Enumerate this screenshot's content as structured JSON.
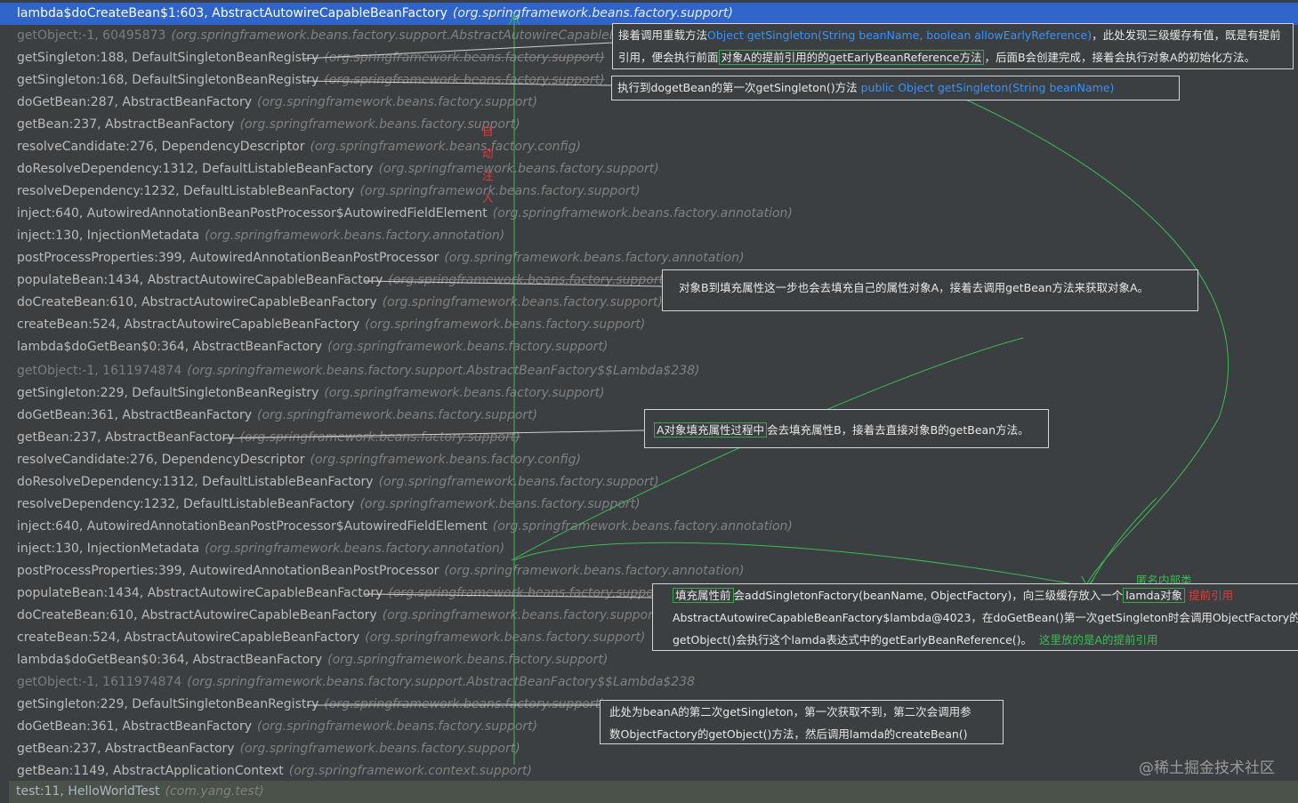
{
  "frames": [
    {
      "method": "lambda$doCreateBean$1:603, AbstractAutowireCapableBeanFactory",
      "pkg": "(org.springframework.beans.factory.support)",
      "selected": true
    },
    {
      "method": "getObject:-1, 60495873",
      "pkg": "(org.springframework.beans.factory.support.AbstractAutowireCapableBeanF",
      "dim": true
    },
    {
      "method": "getSingleton:188, DefaultSingletonBeanRegistry",
      "pkg": "(org.springframework.beans.factory.support)",
      "strike": true
    },
    {
      "method": "getSingleton:168, DefaultSingletonBeanRegistry",
      "pkg": "(org.springframework.beans.factory.support)",
      "strike": true
    },
    {
      "method": "doGetBean:287, AbstractBeanFactory",
      "pkg": "(org.springframework.beans.factory.support)"
    },
    {
      "method": "getBean:237, AbstractBeanFactory",
      "pkg": "(org.springframework.beans.factory.support)"
    },
    {
      "method": "resolveCandidate:276, DependencyDescriptor",
      "pkg": "(org.springframework.beans.factory.config)"
    },
    {
      "method": "doResolveDependency:1312, DefaultListableBeanFactory",
      "pkg": "(org.springframework.beans.factory.support)"
    },
    {
      "method": "resolveDependency:1232, DefaultListableBeanFactory",
      "pkg": "(org.springframework.beans.factory.support)"
    },
    {
      "method": "inject:640, AutowiredAnnotationBeanPostProcessor$AutowiredFieldElement",
      "pkg": "(org.springframework.beans.factory.annotation)"
    },
    {
      "method": "inject:130, InjectionMetadata",
      "pkg": "(org.springframework.beans.factory.annotation)"
    },
    {
      "method": "postProcessProperties:399, AutowiredAnnotationBeanPostProcessor",
      "pkg": "(org.springframework.beans.factory.annotation)"
    },
    {
      "method": "populateBean:1434, AbstractAutowireCapableBeanFactory",
      "pkg": "(org.springframework.beans.factory.support)",
      "strike": true
    },
    {
      "method": "doCreateBean:610, AbstractAutowireCapableBeanFactory",
      "pkg": "(org.springframework.beans.factory.support)"
    },
    {
      "method": "createBean:524, AbstractAutowireCapableBeanFactory",
      "pkg": "(org.springframework.beans.factory.support)"
    },
    {
      "method": "lambda$doGetBean$0:364, AbstractBeanFactory",
      "pkg": "(org.springframework.beans.factory.support)"
    },
    {
      "method": "getObject:-1, 1611974874",
      "pkg": "(org.springframework.beans.factory.support.AbstractBeanFactory$$Lambda$238)",
      "dim": true
    },
    {
      "method": "getSingleton:229, DefaultSingletonBeanRegistry",
      "pkg": "(org.springframework.beans.factory.support)"
    },
    {
      "method": "doGetBean:361, AbstractBeanFactory",
      "pkg": "(org.springframework.beans.factory.support)"
    },
    {
      "method": "getBean:237, AbstractBeanFactory",
      "pkg": "(org.springframework.beans.factory.support)",
      "strike": true
    },
    {
      "method": "resolveCandidate:276, DependencyDescriptor",
      "pkg": "(org.springframework.beans.factory.config)"
    },
    {
      "method": "doResolveDependency:1312, DefaultListableBeanFactory",
      "pkg": "(org.springframework.beans.factory.support)"
    },
    {
      "method": "resolveDependency:1232, DefaultListableBeanFactory",
      "pkg": "(org.springframework.beans.factory.support)"
    },
    {
      "method": "inject:640, AutowiredAnnotationBeanPostProcessor$AutowiredFieldElement",
      "pkg": "(org.springframework.beans.factory.annotation)"
    },
    {
      "method": "inject:130, InjectionMetadata",
      "pkg": "(org.springframework.beans.factory.annotation)"
    },
    {
      "method": "postProcessProperties:399, AutowiredAnnotationBeanPostProcessor",
      "pkg": "(org.springframework.beans.factory.annotation)"
    },
    {
      "method": "populateBean:1434, AbstractAutowireCapableBeanFactory",
      "pkg": "(org.springframework.beans.factory.support)",
      "strike": true
    },
    {
      "method": "doCreateBean:610, AbstractAutowireCapableBeanFactory",
      "pkg": "(org.springframework.beans.factory.support)"
    },
    {
      "method": "createBean:524, AbstractAutowireCapableBeanFactory",
      "pkg": "(org.springframework.beans.factory.support)"
    },
    {
      "method": "lambda$doGetBean$0:364, AbstractBeanFactory",
      "pkg": "(org.springframework.beans.factory.support)"
    },
    {
      "method": "getObject:-1, 1611974874",
      "pkg": "(org.springframework.beans.factory.support.AbstractBeanFactory$$Lambda$238",
      "dim": true
    },
    {
      "method": "getSingleton:229, DefaultSingletonBeanRegistry",
      "pkg": "(org.springframework.beans.factory.support)",
      "strike": true
    },
    {
      "method": "doGetBean:361, AbstractBeanFactory",
      "pkg": "(org.springframework.beans.factory.support)"
    },
    {
      "method": "getBean:237, AbstractBeanFactory",
      "pkg": "(org.springframework.beans.factory.support)"
    },
    {
      "method": "getBean:1149, AbstractApplicationContext",
      "pkg": "(org.springframework.context.support)"
    },
    {
      "method": "test:11, HelloWorldTest",
      "pkg": "(com.yang.test)",
      "last": true
    }
  ],
  "notes": {
    "n1": {
      "line1_a": "接着调用重载方法",
      "line1_code": "Object getSingleton(String beanName, boolean allowEarlyReference)",
      "line1_b": "，此处发现三级缓存有值，既是有提前",
      "line2_a": "引用，便会执行前面",
      "line2_hl": "对象A的提前引用的的getEarlyBeanReference方法",
      "line2_b": "，后面B会创建完成，接着会执行对象A的初始化方法。"
    },
    "n2": {
      "text": "执行到dogetBean的第一次getSingleton()方法 ",
      "code": "public Object getSingleton(String beanName)"
    },
    "n3": {
      "text": "对象B到填充属性这一步也会去填充自己的属性对象A，接着去调用getBean方法来获取对象A。"
    },
    "n4": {
      "hl": "A对象填充属性过程中",
      "text": "会去填充属性B，接着去直接对象B的getBean方法。"
    },
    "n5": {
      "line1_hl": "填充属性前",
      "line1_a": "会addSingletonFactory(beanName, ObjectFactory)，向三级缓存放入一个",
      "line1_hl2": "lamda对象",
      "line1_red": "提前引用",
      "line2": "AbstractAutowireCapableBeanFactory$lambda@4023，在doGetBean()第一次getSingleton时会调用ObjectFactory的",
      "line3_a": "getObject()会执行这个lamda表达式中的getEarlyBeanReference()。",
      "line3_green": "这里放的是A的提前引用"
    },
    "n6": {
      "line1": "此处为beanA的第二次getSingleton，第一次获取不到，第二次会调用参",
      "line2": "数ObjectFactory的getObject()方法，然后调用lamda的createBean()"
    }
  },
  "labels": {
    "anon": "匿名内部类",
    "side_red": "自动注入"
  },
  "watermark": "@稀土掘金技术社区",
  "colors": {
    "background": "#3c3f41",
    "selected": "#2f65ca",
    "annotation_line": "#3dbb54",
    "code_blue": "#3592ff",
    "red": "#e23b3b"
  }
}
